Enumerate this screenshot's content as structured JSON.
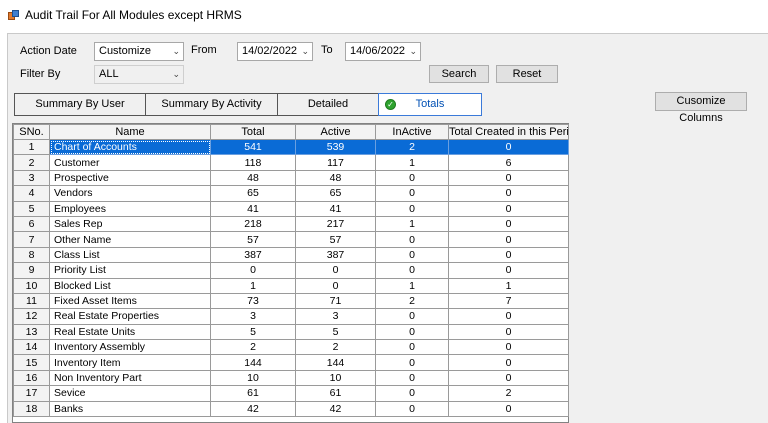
{
  "window": {
    "title": "Audit Trail For All Modules except HRMS"
  },
  "filters": {
    "action_date_label": "Action Date",
    "action_date_value": "Customize",
    "from_label": "From",
    "from_value": "14/02/2022",
    "to_label": "To",
    "to_value": "14/06/2022",
    "filter_by_label": "Filter By",
    "filter_by_value": "ALL"
  },
  "buttons": {
    "search": "Search",
    "reset": "Reset",
    "customize_columns": "Cusomize Columns"
  },
  "tabs": [
    {
      "label": "Summary By User"
    },
    {
      "label": "Summary By Activity"
    },
    {
      "label": "Detailed"
    },
    {
      "label": "Totals",
      "active": true
    }
  ],
  "grid": {
    "columns": [
      "SNo.",
      "Name",
      "Total",
      "Active",
      "InActive",
      "Total Created in this Period"
    ],
    "rows": [
      [
        "1",
        "Chart of Accounts",
        "541",
        "539",
        "2",
        "0"
      ],
      [
        "2",
        "Customer",
        "118",
        "117",
        "1",
        "6"
      ],
      [
        "3",
        "Prospective",
        "48",
        "48",
        "0",
        "0"
      ],
      [
        "4",
        "Vendors",
        "65",
        "65",
        "0",
        "0"
      ],
      [
        "5",
        "Employees",
        "41",
        "41",
        "0",
        "0"
      ],
      [
        "6",
        "Sales Rep",
        "218",
        "217",
        "1",
        "0"
      ],
      [
        "7",
        "Other Name",
        "57",
        "57",
        "0",
        "0"
      ],
      [
        "8",
        "Class List",
        "387",
        "387",
        "0",
        "0"
      ],
      [
        "9",
        "Priority List",
        "0",
        "0",
        "0",
        "0"
      ],
      [
        "10",
        "Blocked List",
        "1",
        "0",
        "1",
        "1"
      ],
      [
        "11",
        "Fixed Asset Items",
        "73",
        "71",
        "2",
        "7"
      ],
      [
        "12",
        "Real Estate Properties",
        "3",
        "3",
        "0",
        "0"
      ],
      [
        "13",
        "Real Estate Units",
        "5",
        "5",
        "0",
        "0"
      ],
      [
        "14",
        "Inventory Assembly",
        "2",
        "2",
        "0",
        "0"
      ],
      [
        "15",
        "Inventory Item",
        "144",
        "144",
        "0",
        "0"
      ],
      [
        "16",
        "Non Inventory Part",
        "10",
        "10",
        "0",
        "0"
      ],
      [
        "17",
        "Sevice",
        "61",
        "61",
        "0",
        "2"
      ],
      [
        "18",
        "Banks",
        "42",
        "42",
        "0",
        "0"
      ]
    ],
    "selected_row": 0
  }
}
